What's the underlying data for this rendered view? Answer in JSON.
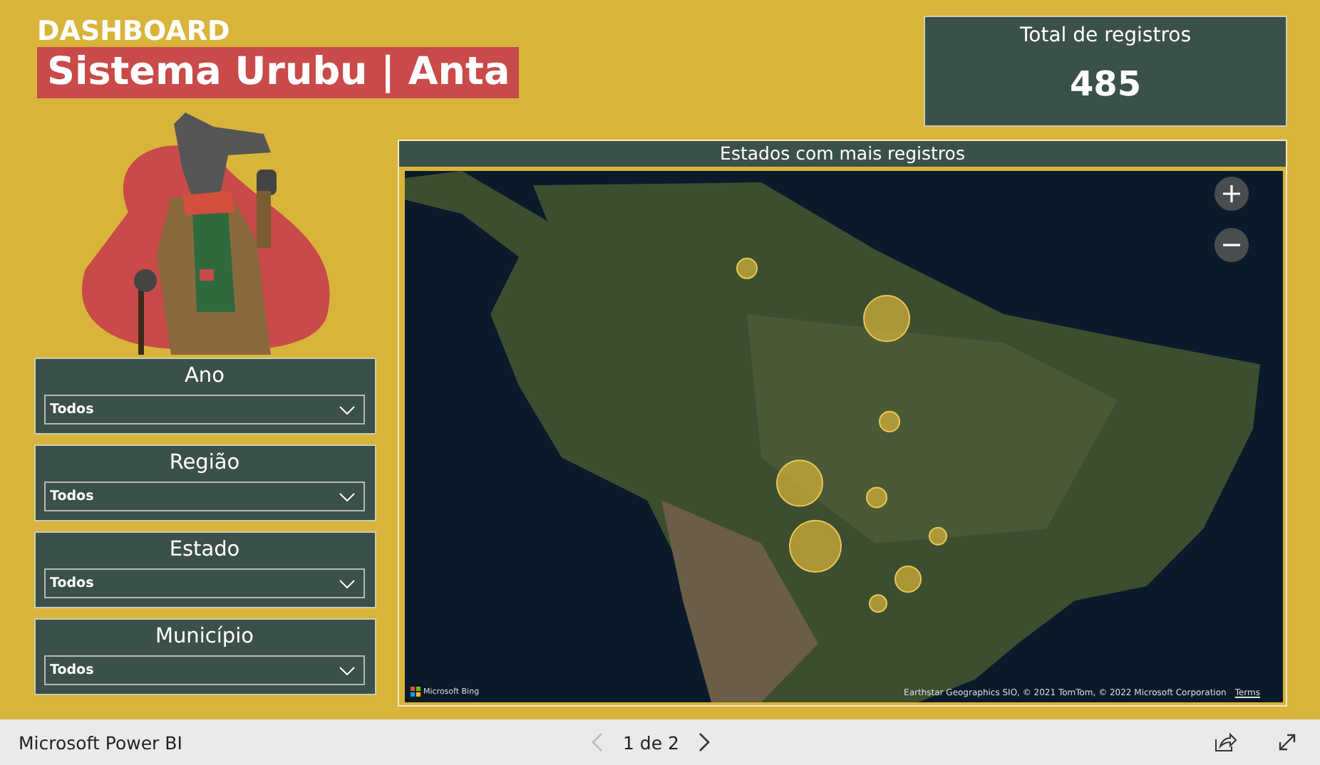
{
  "header": {
    "eyebrow": "DASHBOARD",
    "title": "Sistema Urubu | Anta"
  },
  "total_card": {
    "label": "Total de registros",
    "value": "485"
  },
  "filters": [
    {
      "label": "Ano",
      "value": "Todos"
    },
    {
      "label": "Região",
      "value": "Todos"
    },
    {
      "label": "Estado",
      "value": "Todos"
    },
    {
      "label": "Município",
      "value": "Todos"
    }
  ],
  "map": {
    "title": "Estados com mais registros",
    "brand": "Microsoft Bing",
    "attribution": "Earthstar Geographics SIO, © 2021 TomTom, © 2022 Microsoft Corporation",
    "terms_link": "Terms"
  },
  "footer": {
    "app_name": "Microsoft Power BI",
    "page_indicator": "1 de 2",
    "prev_disabled": true,
    "next_disabled": false
  }
}
